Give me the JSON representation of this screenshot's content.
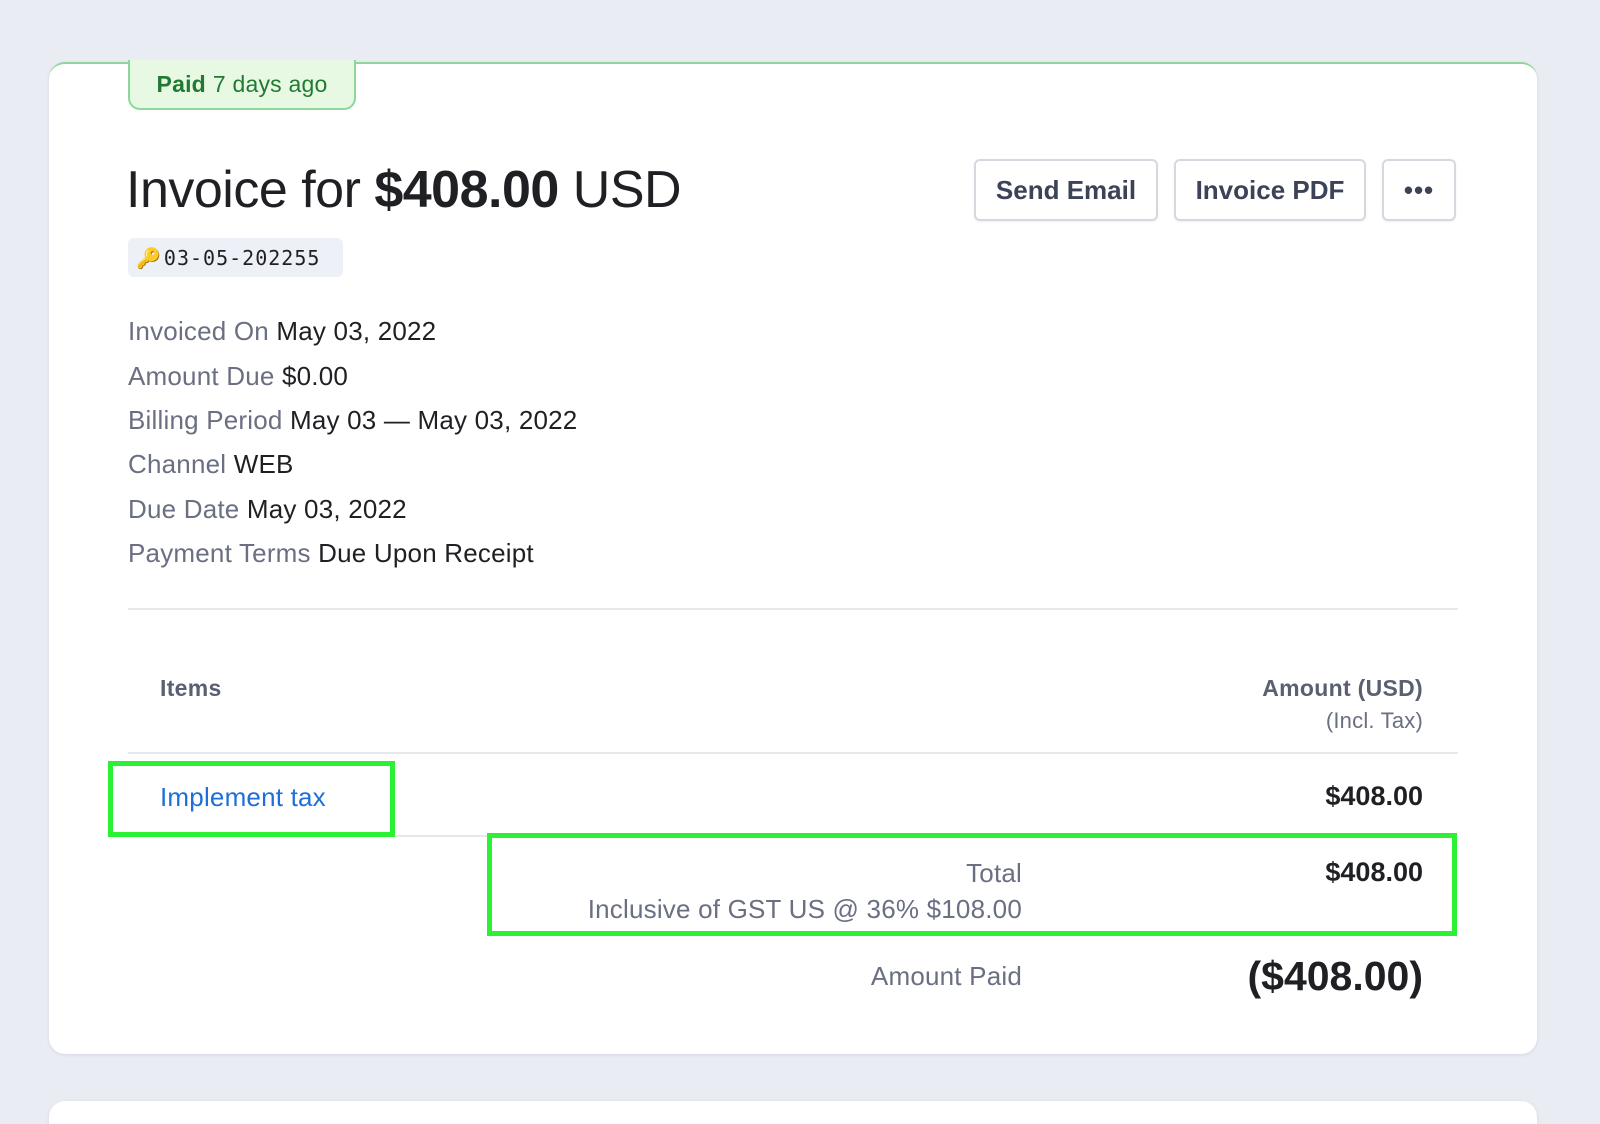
{
  "status": {
    "label": "Paid",
    "detail": "7 days ago"
  },
  "header": {
    "title_prefix": "Invoice for",
    "amount": "$408.00",
    "currency": "USD",
    "invoice_number": "03-05-202255",
    "key_icon": "key-icon"
  },
  "actions": {
    "send_email": "Send Email",
    "invoice_pdf": "Invoice PDF",
    "more": "•••"
  },
  "details": [
    {
      "label": "Invoiced On",
      "value": "May 03, 2022"
    },
    {
      "label": "Amount Due",
      "value": "$0.00"
    },
    {
      "label": "Billing Period",
      "value": "May 03 — May 03, 2022"
    },
    {
      "label": "Channel",
      "value": "WEB"
    },
    {
      "label": "Due Date",
      "value": "May 03, 2022"
    },
    {
      "label": "Payment Terms",
      "value": "Due Upon Receipt"
    }
  ],
  "table": {
    "items_header": "Items",
    "amount_header": "Amount (USD)",
    "amount_subheader": "(Incl. Tax)",
    "rows": [
      {
        "name": "Implement tax",
        "amount": "$408.00"
      }
    ]
  },
  "summary": {
    "total_label": "Total",
    "total_value": "$408.00",
    "tax_note": "Inclusive of GST US @ 36% $108.00",
    "paid_label": "Amount Paid",
    "paid_value": "($408.00)"
  },
  "colors": {
    "paid_green": "#217a32",
    "link_blue": "#1e6fd9",
    "highlight_green": "#2bf033"
  }
}
